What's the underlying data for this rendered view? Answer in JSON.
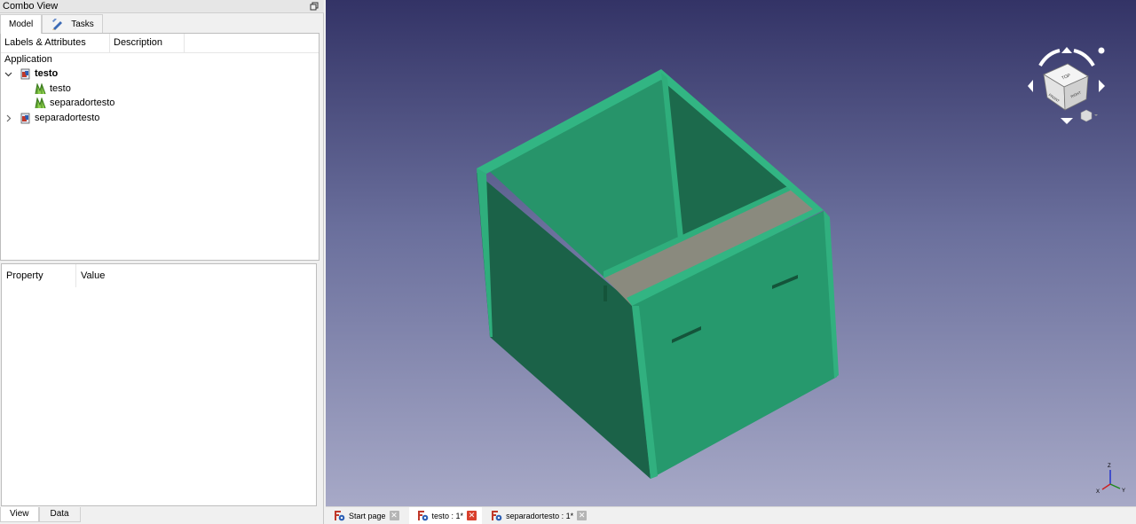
{
  "combo_view": {
    "title": "Combo View"
  },
  "top_tabs": [
    {
      "label": "Model",
      "active": true
    },
    {
      "label": "Tasks",
      "icon": "pencil-ruler-icon"
    }
  ],
  "tree": {
    "columns": [
      "Labels & Attributes",
      "Description"
    ],
    "root_label": "Application",
    "items": [
      {
        "label": "testo",
        "bold": true,
        "expanded": true,
        "icon": "freecad-document-icon"
      },
      {
        "label": "testo",
        "icon": "mesh-icon"
      },
      {
        "label": "separadortesto",
        "icon": "mesh-icon"
      },
      {
        "label": "separadortesto",
        "expanded": false,
        "icon": "freecad-document-icon"
      }
    ]
  },
  "properties": {
    "columns": [
      "Property",
      "Value"
    ]
  },
  "bottom_tabs": [
    {
      "label": "View",
      "active": true
    },
    {
      "label": "Data"
    }
  ],
  "document_tabs": [
    {
      "label": "Start page",
      "icon": "freecad-icon",
      "close": "grey"
    },
    {
      "label": "testo : 1*",
      "icon": "freecad-icon",
      "active": true,
      "close": "red"
    },
    {
      "label": "separadortesto : 1*",
      "icon": "freecad-icon",
      "close": "grey"
    }
  ],
  "viewport": {
    "background_top": "#333366",
    "background_bottom": "#a7a9c7",
    "model_color": "#26996d",
    "divider_color": "#8a8a7e",
    "nav_cube_faces": [
      "FRONT",
      "TOP",
      "RIGHT"
    ],
    "axis_labels": [
      "Z",
      "Y",
      "X"
    ]
  }
}
